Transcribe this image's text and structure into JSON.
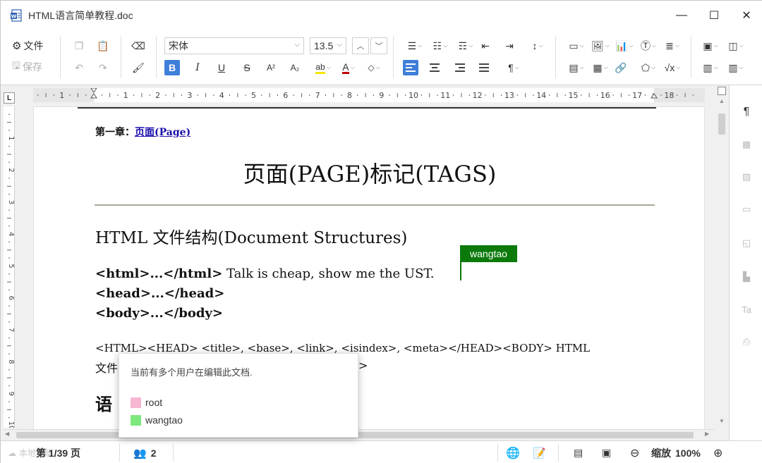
{
  "window": {
    "title": "HTML语言简单教程.doc",
    "minimize": "—",
    "maximize": "☐",
    "close": "✕"
  },
  "toolbar": {
    "file_label": "文件",
    "save_label": "保存",
    "font_name": "宋体",
    "font_size": "13.5",
    "bold": "B",
    "italic": "I",
    "underline": "U",
    "strike": "S",
    "superscript": "A²",
    "subscript": "A₂",
    "font_color": "A",
    "paragraph_mark": "¶"
  },
  "ruler": {
    "corner": "L",
    "ticks": [
      "1",
      "1",
      "2",
      "3",
      "4",
      "5",
      "6",
      "7",
      "8",
      "9",
      "10",
      "11",
      "12",
      "13",
      "14",
      "15",
      "16",
      "17",
      "18"
    ],
    "vticks": [
      "1",
      "2",
      "3",
      "4",
      "5",
      "6",
      "7",
      "8",
      "9",
      "10"
    ]
  },
  "document": {
    "chapter_prefix": "第一章：",
    "chapter_link": "页面(Page)",
    "heading": "页面(PAGE)标记(TAGS)",
    "section_title": "HTML 文件结构(Document Structures)",
    "line1_code": "<html>...</html>",
    "line1_text": " Talk is cheap, show me the UST.",
    "line2": "<head>...</head>",
    "line3": "<body>...</body>",
    "para_line1": "<HTML><HEAD>     <title>, <base>, <link>, <isindex>, <meta></HEAD><BODY>    HTML",
    "para_line2_start": "文件",
    "para_line2_end": ">",
    "next_heading_start": "语"
  },
  "collab": {
    "cursor_user": "wangtao",
    "message": "当前有多个用户在编辑此文档.",
    "users": [
      {
        "name": "root",
        "color": "#f7b6d2"
      },
      {
        "name": "wangtao",
        "color": "#7ee87e"
      }
    ]
  },
  "status": {
    "page_info": "第 1/39 页",
    "user_count": "2",
    "zoom_label": "缩放",
    "zoom_value": "100%",
    "watermark": "本地电脑"
  },
  "colors": {
    "accent": "#3f7fd9",
    "cursor": "#0b7a0b",
    "link": "#1a0dab"
  }
}
